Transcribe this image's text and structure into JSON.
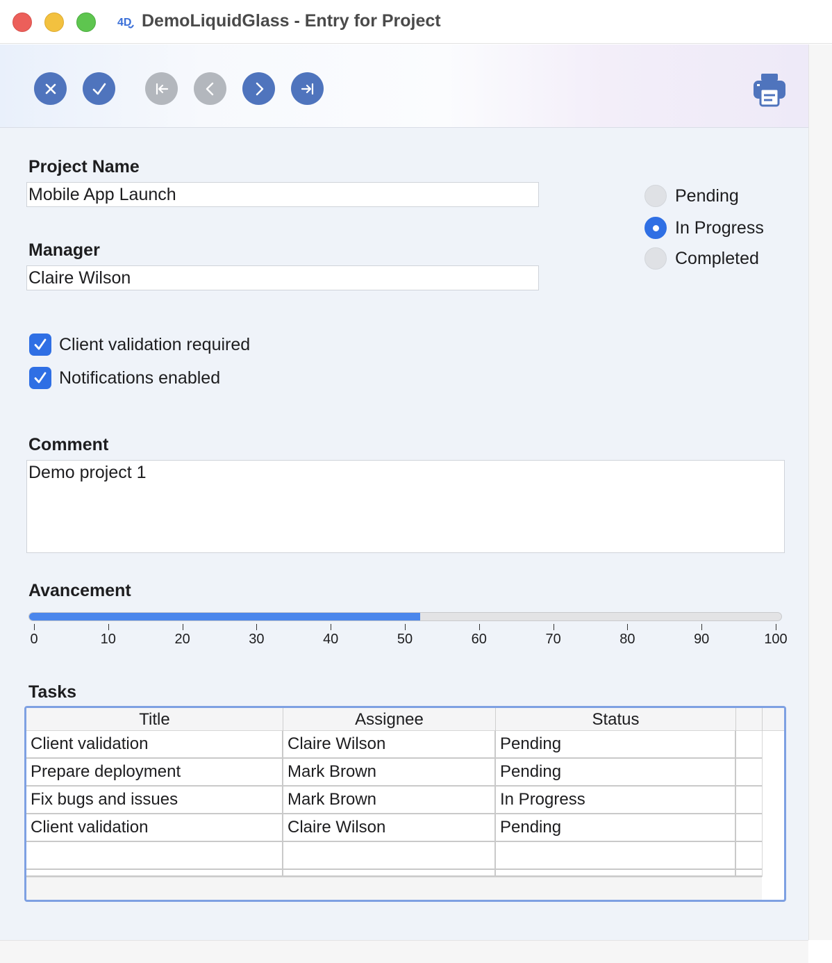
{
  "window": {
    "title": "DemoLiquidGlass - Entry for Project"
  },
  "toolbar": {
    "buttons": [
      {
        "name": "cancel-button",
        "icon": "close-icon",
        "enabled": true
      },
      {
        "name": "validate-button",
        "icon": "checkmark-icon",
        "enabled": true
      },
      {
        "name": "first-record-button",
        "icon": "first-record-icon",
        "enabled": false
      },
      {
        "name": "previous-record-button",
        "icon": "chevron-left-icon",
        "enabled": false
      },
      {
        "name": "next-record-button",
        "icon": "chevron-right-icon",
        "enabled": true
      },
      {
        "name": "last-record-button",
        "icon": "last-record-icon",
        "enabled": true
      }
    ],
    "print_icon": "printer-icon"
  },
  "form": {
    "project_name_label": "Project Name",
    "project_name_value": "Mobile App Launch",
    "manager_label": "Manager",
    "manager_value": "Claire Wilson",
    "status_options": [
      {
        "label": "Pending",
        "selected": false
      },
      {
        "label": "In Progress",
        "selected": true
      },
      {
        "label": "Completed",
        "selected": false
      }
    ],
    "client_validation_label": "Client validation required",
    "client_validation_checked": true,
    "notifications_label": "Notifications enabled",
    "notifications_checked": true,
    "comment_label": "Comment",
    "comment_value": "Demo project 1",
    "progress_label": "Avancement",
    "progress_value": 52,
    "progress_ticks": [
      "0",
      "10",
      "20",
      "30",
      "40",
      "50",
      "60",
      "70",
      "80",
      "90",
      "100"
    ]
  },
  "tasks": {
    "label": "Tasks",
    "columns": [
      "Title",
      "Assignee",
      "Status"
    ],
    "rows": [
      [
        "Client validation",
        "Claire Wilson",
        "Pending"
      ],
      [
        "Prepare deployment",
        "Mark Brown",
        "Pending"
      ],
      [
        "Fix bugs and issues",
        "Mark Brown",
        "In Progress"
      ],
      [
        "Client validation",
        "Claire Wilson",
        "Pending"
      ]
    ]
  },
  "colors": {
    "accent": "#2f6fe4",
    "toolbar_button": "#4f74bd",
    "toolbar_button_disabled": "#b3b7bd",
    "table_focus_border": "#7ea0e2",
    "progress_fill": "#4a86ec"
  }
}
